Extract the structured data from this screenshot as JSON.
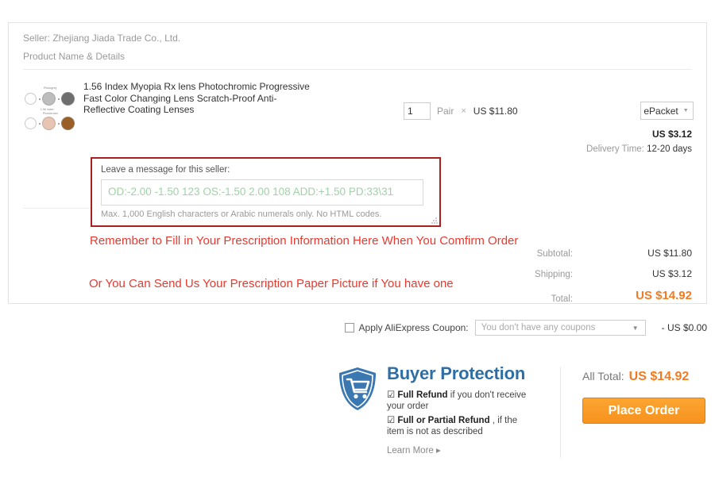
{
  "order": {
    "seller_line": "Seller: Zhejiang Jiada Trade Co., Ltd.",
    "product_section_label": "Product Name & Details",
    "product_title": "1.56 Index Myopia Rx lens Photochromic Progressive Fast Color Changing Lens Scratch-Proof Anti-Reflective Coating Lenses",
    "thumbnail": {
      "caption_top": "Photogrey",
      "caption_middle": "1.56 index",
      "caption_bottom": "Photobrown"
    },
    "quantity": "1",
    "quantity_unit": "Pair",
    "multiply_symbol": "×",
    "unit_price": "US $11.80",
    "shipping_method": "ePacket",
    "shipping_price": "US $3.12",
    "delivery_time_label": "Delivery Time:",
    "delivery_time_value": "12-20 days"
  },
  "message": {
    "label": "Leave a message for this seller:",
    "placeholder": "OD:-2.00 -1.50 123 OS:-1.50 2.00 108 ADD:+1.50 PD:33\\31",
    "hint": "Max. 1,000 English characters or Arabic numerals only. No HTML codes."
  },
  "annotations": {
    "line1": "Remember to Fill in Your Prescription Information Here When You Comfirm Order",
    "line2": "Or You Can Send Us Your Prescription Paper Picture if You have one",
    "color": "#e8392f"
  },
  "totals": {
    "subtotal_label": "Subtotal:",
    "subtotal_value": "US $11.80",
    "shipping_label": "Shipping:",
    "shipping_value": "US $3.12",
    "total_label": "Total:",
    "total_value": "US $14.92"
  },
  "coupon": {
    "label": "Apply AliExpress Coupon:",
    "select_value": "You don't have any coupons",
    "discount": "- US $0.00"
  },
  "buyer_protection": {
    "title": "Buyer Protection",
    "item1_bold": "Full Refund",
    "item1_rest": " if you don't receive your order",
    "item2_bold": "Full or Partial Refund",
    "item2_rest": " , if the item is not as described",
    "learn_more": "Learn More ▸",
    "title_color": "#2f6ea5"
  },
  "checkout": {
    "all_total_label": "All Total:",
    "all_total_value": "US $14.92",
    "place_order_label": "Place Order",
    "accent_color": "#f47a20"
  }
}
